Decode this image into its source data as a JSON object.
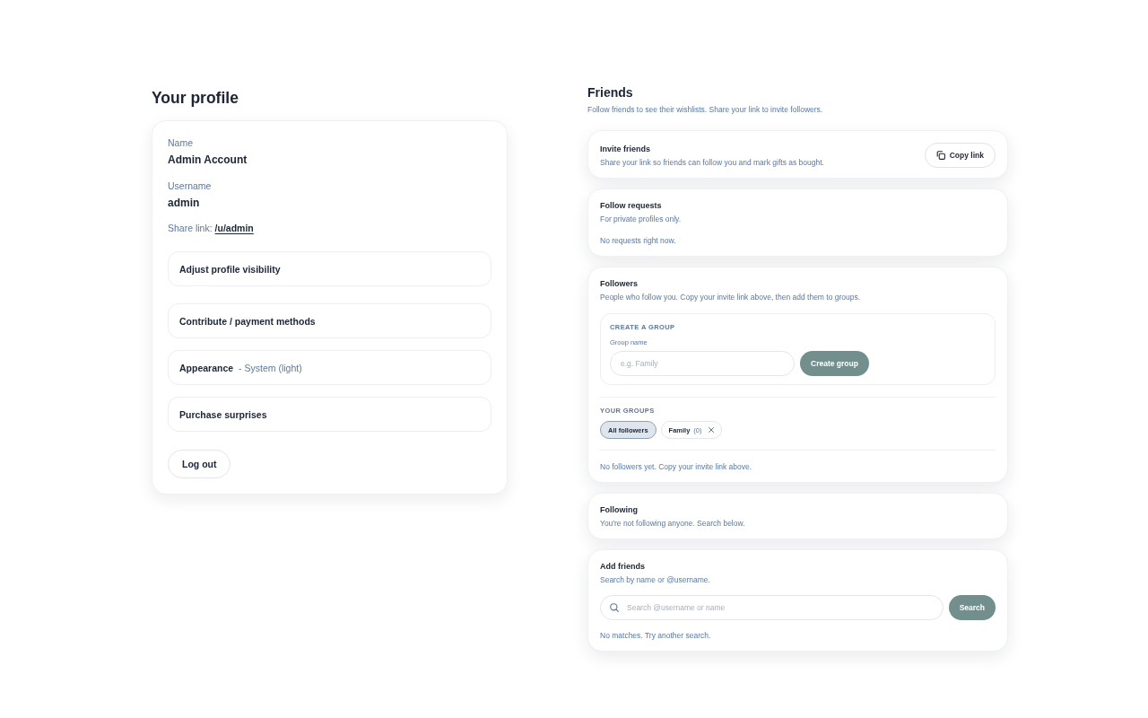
{
  "profile": {
    "title": "Your profile",
    "fields": [
      {
        "label": "Name",
        "value": "Admin Account"
      },
      {
        "label": "Username",
        "value": "admin"
      }
    ],
    "share_link": {
      "label": "Share link:",
      "url": "/u/admin"
    },
    "settings": [
      {
        "label": "Adjust profile visibility"
      },
      {
        "label": "Contribute / payment methods"
      },
      {
        "label": "Appearance",
        "detail": "- System (light)"
      },
      {
        "label": "Purchase surprises"
      }
    ],
    "logout_button": "Log out"
  },
  "friends": {
    "title": "Friends",
    "subtitle": "Follow friends to see their wishlists. Share your link to invite followers.",
    "cards": [
      {
        "kind": "invite",
        "title": "Invite friends",
        "description": "Share your link so friends can follow you and mark gifts as bought.",
        "button": "Copy link"
      },
      {
        "kind": "requests",
        "title": "Follow requests",
        "description": "For private profiles only.",
        "empty_text": "No requests right now."
      },
      {
        "kind": "followers",
        "title": "Followers",
        "description": "People who follow you. Copy your invite link above, then add them to groups.",
        "create_group": {
          "heading": "CREATE A GROUP",
          "field_label": "Group name",
          "placeholder": "e.g. Family",
          "button": "Create group"
        },
        "groups": {
          "heading": "YOUR GROUPS",
          "chips": [
            {
              "label": "All followers",
              "selected": true,
              "removable": false
            },
            {
              "label": "Family",
              "count": "(0)",
              "selected": false,
              "removable": true
            }
          ]
        },
        "empty_text": "No followers yet. Copy your invite link above."
      },
      {
        "kind": "following",
        "title": "Following",
        "description": "You're not following anyone. Search below."
      },
      {
        "kind": "search",
        "title": "Add friends",
        "description": "Search by name or @username.",
        "search": {
          "placeholder": "Search @username or name",
          "button": "Search"
        },
        "empty_text": "No matches. Try another search."
      }
    ]
  }
}
